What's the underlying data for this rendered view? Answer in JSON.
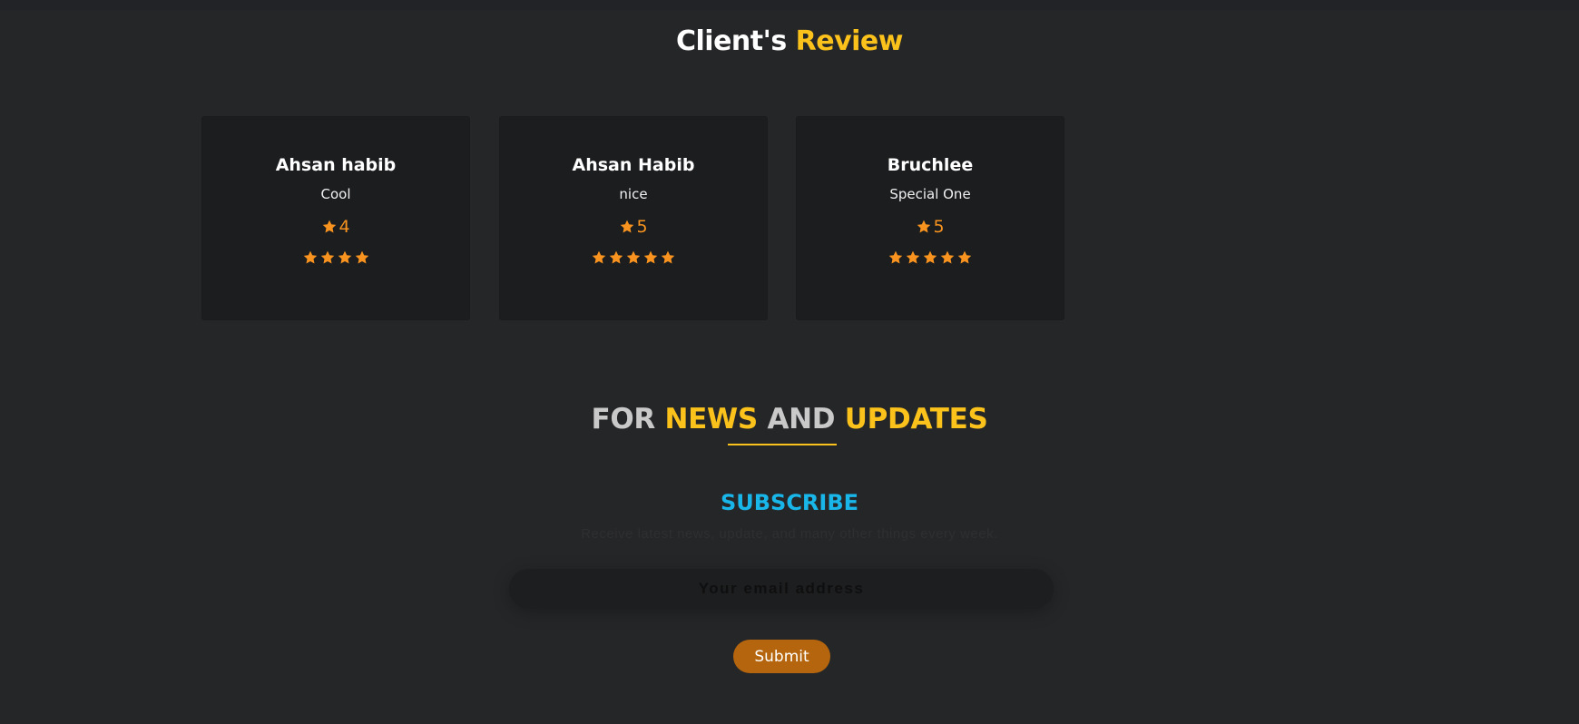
{
  "reviews": {
    "title_part1": "Client's ",
    "title_part2": "Review",
    "cards": [
      {
        "name": "Ahsan habib",
        "comment": "Cool",
        "rating": "4",
        "stars": 4
      },
      {
        "name": "Ahsan Habib",
        "comment": "nice",
        "rating": "5",
        "stars": 5
      },
      {
        "name": "Bruchlee",
        "comment": "Special One",
        "rating": "5",
        "stars": 5
      }
    ]
  },
  "newsletter": {
    "title_for": "FOR ",
    "title_news": "NEWS",
    "title_and": " AND ",
    "title_updates": "UPDATES",
    "subscribe_label": "SUBSCRIBE",
    "subtitle": "Receive latest news, update, and many other things every week.",
    "email_placeholder": "Your email address",
    "submit_label": "Submit"
  },
  "colors": {
    "accent_yellow": "#fbc21b",
    "star_orange": "#f7931e",
    "subscribe_blue": "#19b6ea",
    "submit_button": "#b5650d"
  }
}
